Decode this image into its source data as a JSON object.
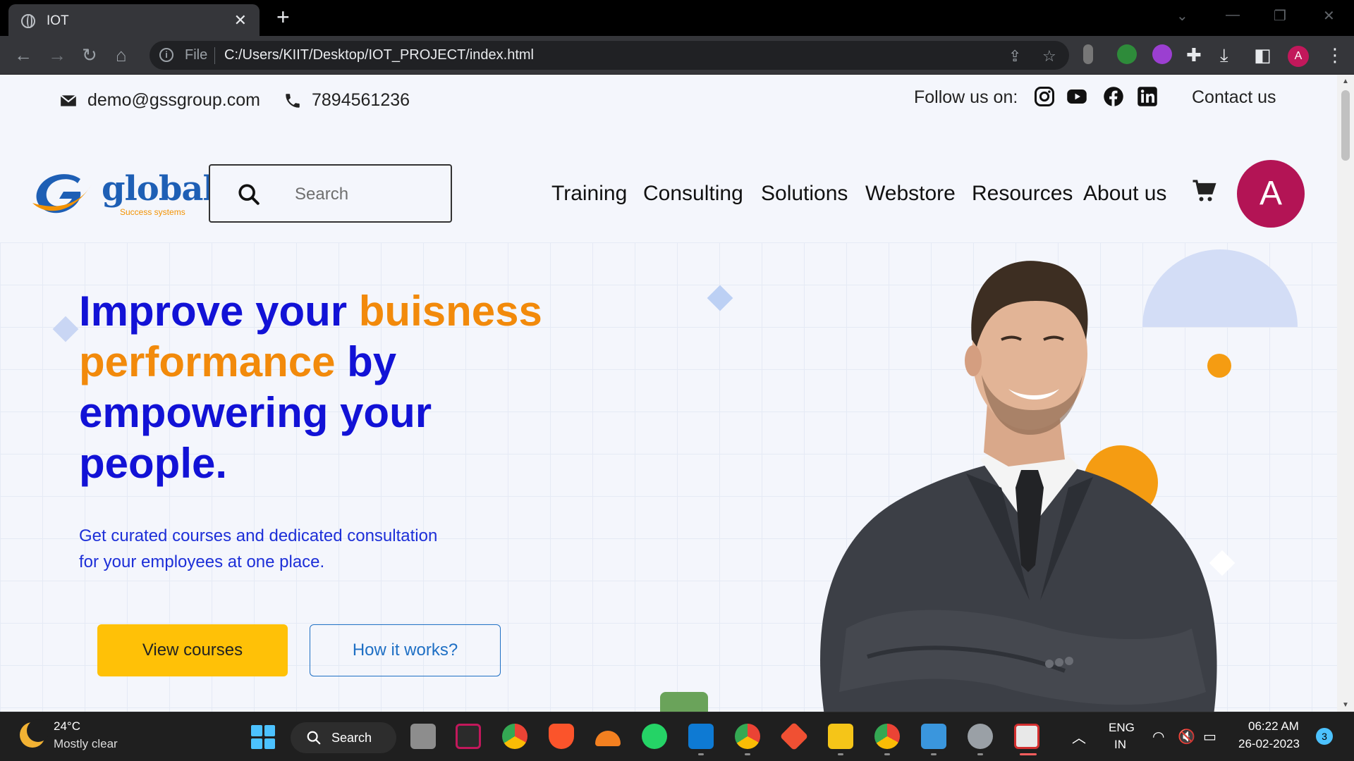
{
  "browser": {
    "tab_title": "IOT",
    "url_scheme": "File",
    "url": "C:/Users/KIIT/Desktop/IOT_PROJECT/index.html",
    "profile_initial": "A"
  },
  "topbar": {
    "email": "demo@gssgroup.com",
    "phone": "7894561236",
    "follow_label": "Follow us on:",
    "contact": "Contact us"
  },
  "header": {
    "logo_word": "global",
    "logo_tagline": "Success systems",
    "search_placeholder": "Search",
    "nav": [
      "Training",
      "Consulting",
      "Solutions",
      "Webstore",
      "Resources",
      "About us"
    ],
    "avatar_initial": "A"
  },
  "hero": {
    "title_part1": "Improve your ",
    "title_accent1": "buisness performance",
    "title_part2": " by empowering your people.",
    "subtitle": "Get curated courses and dedicated consultation for your employees at one place.",
    "primary_button": "View courses",
    "secondary_button": "How it works?"
  },
  "colors": {
    "brand_blue": "#1212d6",
    "accent_orange": "#f28a0b",
    "button_yellow": "#ffc107",
    "avatar": "#b31455"
  },
  "taskbar": {
    "temperature": "24°C",
    "weather": "Mostly clear",
    "search_label": "Search",
    "lang_line1": "ENG",
    "lang_line2": "IN",
    "time": "06:22 AM",
    "date": "26-02-2023",
    "notifications": "3"
  }
}
